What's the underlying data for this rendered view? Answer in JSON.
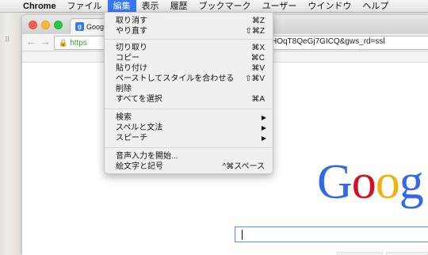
{
  "menubar": {
    "items": [
      {
        "label": "Chrome"
      },
      {
        "label": "ファイル"
      },
      {
        "label": "編集"
      },
      {
        "label": "表示"
      },
      {
        "label": "履歴"
      },
      {
        "label": "ブックマーク"
      },
      {
        "label": "ユーザー"
      },
      {
        "label": "ウインドウ"
      },
      {
        "label": "ヘルプ"
      }
    ]
  },
  "browser": {
    "tab_title": "Google",
    "url_scheme": "https",
    "url_tail": "HOqT8QeGj7GICQ&gws_rd=ssl"
  },
  "page": {
    "logo_letters": [
      "G",
      "o",
      "o",
      "g"
    ],
    "logo_colors": [
      "#3369e8",
      "#d50f25",
      "#eeb211",
      "#3369e8"
    ]
  },
  "edit_menu": {
    "group1": [
      {
        "label": "取り消す",
        "shortcut": "⌘Z"
      },
      {
        "label": "やり直す",
        "shortcut": "⇧⌘Z"
      }
    ],
    "group2": [
      {
        "label": "切り取り",
        "shortcut": "⌘X"
      },
      {
        "label": "コピー",
        "shortcut": "⌘C"
      },
      {
        "label": "貼り付け",
        "shortcut": "⌘V"
      },
      {
        "label": "ペーストしてスタイルを合わせる",
        "shortcut": "⇧⌘V"
      },
      {
        "label": "削除",
        "shortcut": ""
      },
      {
        "label": "すべてを選択",
        "shortcut": "⌘A"
      }
    ],
    "group3": [
      {
        "label": "検索"
      },
      {
        "label": "スペルと文法"
      },
      {
        "label": "スピーチ"
      }
    ],
    "group4": [
      {
        "label": "音声入力を開始...",
        "shortcut": ""
      },
      {
        "label": "絵文字と記号",
        "shortcut": "^⌘スペース"
      }
    ]
  }
}
